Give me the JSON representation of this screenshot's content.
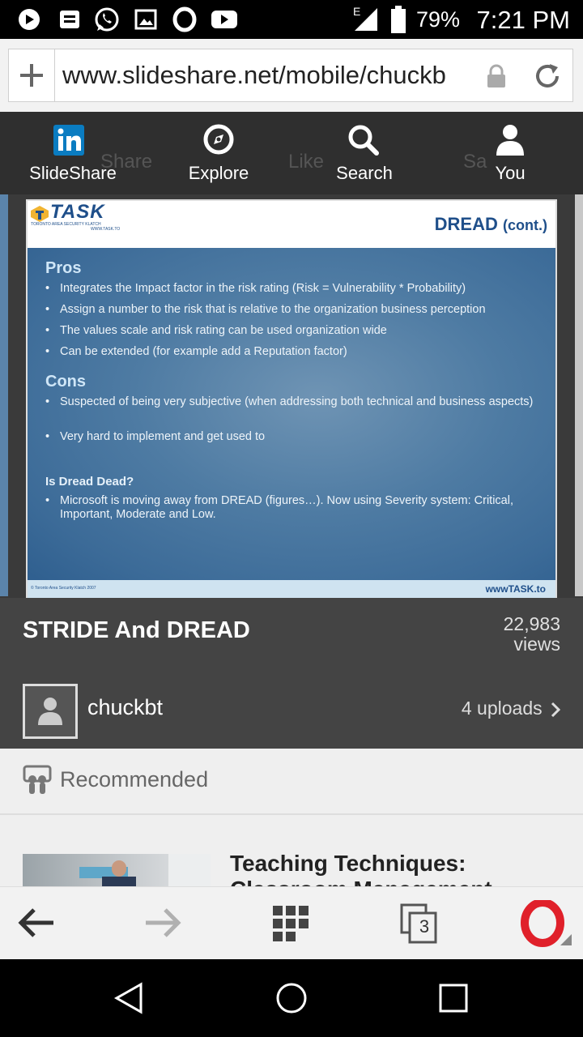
{
  "status_bar": {
    "network": "E",
    "battery_percent": "79%",
    "time": "7:21 PM"
  },
  "browser": {
    "url": "www.slideshare.net/mobile/chuckb",
    "tab_count": "3"
  },
  "app_nav": {
    "items": [
      {
        "label": "SlideShare",
        "icon": "linkedin-icon"
      },
      {
        "label": "Explore",
        "icon": "compass-icon"
      },
      {
        "label": "Search",
        "icon": "search-icon"
      },
      {
        "label": "You",
        "icon": "user-icon"
      }
    ],
    "ghost_actions": [
      "Share",
      "Like",
      "Sa"
    ]
  },
  "slide": {
    "logo_text": "TASK",
    "logo_subtitle": "TORONTO AREA SECURITY KLATCH",
    "logo_url": "WWW.TASK.TO",
    "title": "DREAD",
    "title_suffix": "(cont.)",
    "pros_heading": "Pros",
    "pros": [
      "Integrates the Impact factor in the risk rating (Risk = Vulnerability * Probability)",
      "Assign a number to the risk that is relative to the organization business perception",
      "The values scale  and risk rating can be used organization wide",
      "Can be extended  (for example  add a Reputation factor)"
    ],
    "cons_heading": "Cons",
    "cons": [
      "Suspected of being very subjective (when addressing both technical and business aspects)",
      "Very hard to implement and get used to"
    ],
    "dead_heading": "Is Dread Dead?",
    "dead_items": [
      "Microsoft is moving away from DREAD (figures…). Now using Severity system: Critical, Important, Moderate and Low."
    ],
    "footer_left": "© Toronto Area Security Klatch 2007",
    "footer_right": "wwwTASK.to"
  },
  "document": {
    "title": "STRIDE And DREAD",
    "views_number": "22,983",
    "views_label": "views",
    "author": "chuckbt",
    "uploads": "4 uploads"
  },
  "recommended": {
    "label": "Recommended",
    "first_title": "Teaching Techniques: Classroom Management"
  },
  "colors": {
    "nav_bg": "#2f2f2f",
    "title_bg": "#444444",
    "opera_red": "#e0202a",
    "linkedin_blue": "#0a7cc1"
  }
}
